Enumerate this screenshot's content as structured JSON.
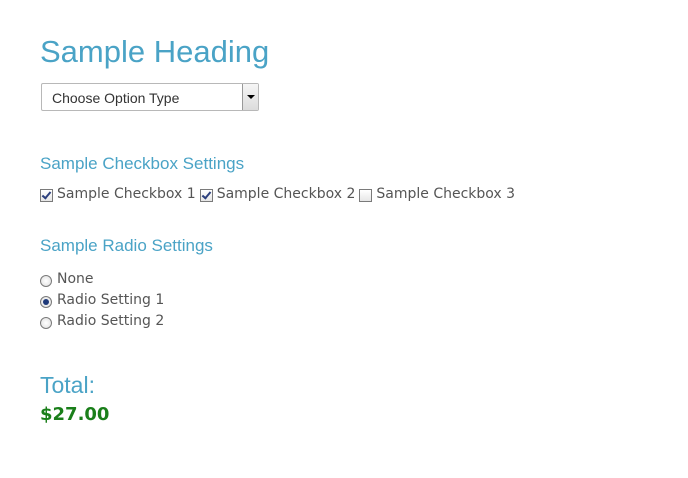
{
  "heading": "Sample Heading",
  "select": {
    "value": "Choose Option Type"
  },
  "checkbox_section": {
    "title": "Sample Checkbox Settings",
    "items": [
      {
        "label": "Sample Checkbox 1",
        "checked": true
      },
      {
        "label": "Sample Checkbox 2",
        "checked": true
      },
      {
        "label": "Sample Checkbox 3",
        "checked": false
      }
    ]
  },
  "radio_section": {
    "title": "Sample Radio Settings",
    "items": [
      {
        "label": "None",
        "checked": false
      },
      {
        "label": "Radio Setting 1",
        "checked": true
      },
      {
        "label": "Radio Setting 2",
        "checked": false
      }
    ]
  },
  "total": {
    "label": "Total:",
    "value": "$27.00",
    "value_color": "#1a7f1a"
  },
  "colors": {
    "accent": "#4aa3c6"
  }
}
